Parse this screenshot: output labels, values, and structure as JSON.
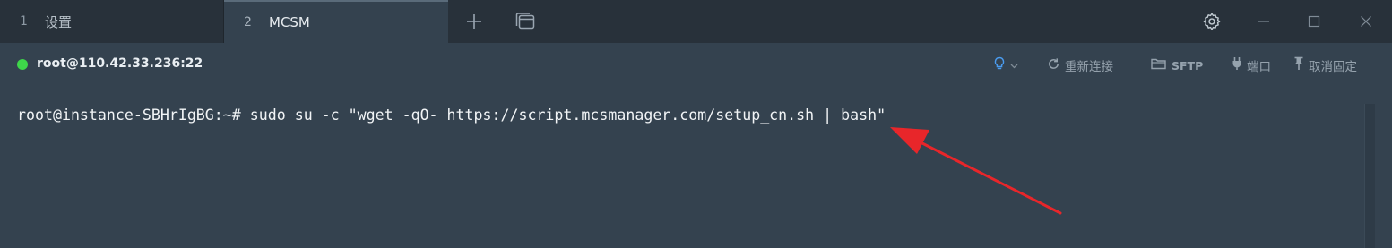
{
  "tabs": [
    {
      "number": "1",
      "label": "设置"
    },
    {
      "number": "2",
      "label": "MCSM"
    }
  ],
  "toolbar": {
    "add_tab_icon": "plus-icon",
    "multi_window_icon": "window-stack-icon",
    "settings_icon": "gear-icon"
  },
  "window_controls": [
    "minimize-icon",
    "maximize-icon",
    "close-icon"
  ],
  "connection": {
    "status": "connected",
    "status_color": "#3ed64a",
    "host": "root@110.42.33.236:22"
  },
  "actions": {
    "bulb_icon": "lightbulb-icon",
    "reconnect": "重新连接",
    "sftp": "SFTP",
    "port": "端口",
    "unpin": "取消固定"
  },
  "terminal": {
    "prompt": "root@instance-SBHrIgBG:~# ",
    "command": "sudo su -c \"wget -qO- https://script.mcsmanager.com/setup_cn.sh | bash\""
  },
  "annotation": {
    "type": "red-arrow",
    "color": "#e8262a"
  }
}
